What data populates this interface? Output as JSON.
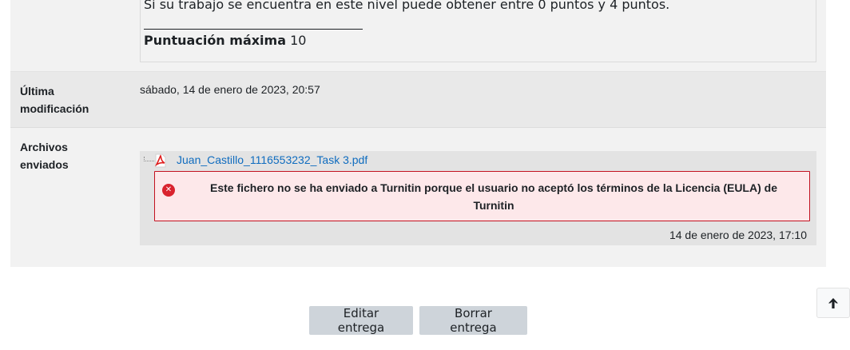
{
  "rubric": {
    "level_description": "Si su trabajo se encuentra en este nivel puede obtener entre 0 puntos y 4 puntos.",
    "max_score_label": "Puntuación máxima",
    "max_score_value": "10"
  },
  "last_modified": {
    "label": "Última modificación",
    "value": "sábado, 14 de enero de 2023, 20:57"
  },
  "submitted_files": {
    "label": "Archivos enviados",
    "file": {
      "name": "Juan_Castillo_1116553232_Task 3.pdf",
      "icon": "pdf-icon",
      "date": "14 de enero de 2023, 17:10"
    },
    "alert": {
      "icon": "error-icon",
      "message": "Este fichero no se ha enviado a Turnitin porque el usuario no aceptó los términos de la Licencia (EULA) de Turnitin"
    }
  },
  "actions": {
    "edit_label": "Editar entrega",
    "delete_label": "Borrar entrega"
  },
  "back_to_top": {
    "icon": "arrow-up-icon"
  },
  "colors": {
    "link": "#0f6cbf",
    "alert_bg": "#fde8ea",
    "alert_border": "#c2111f",
    "button_bg": "#ced4da"
  }
}
